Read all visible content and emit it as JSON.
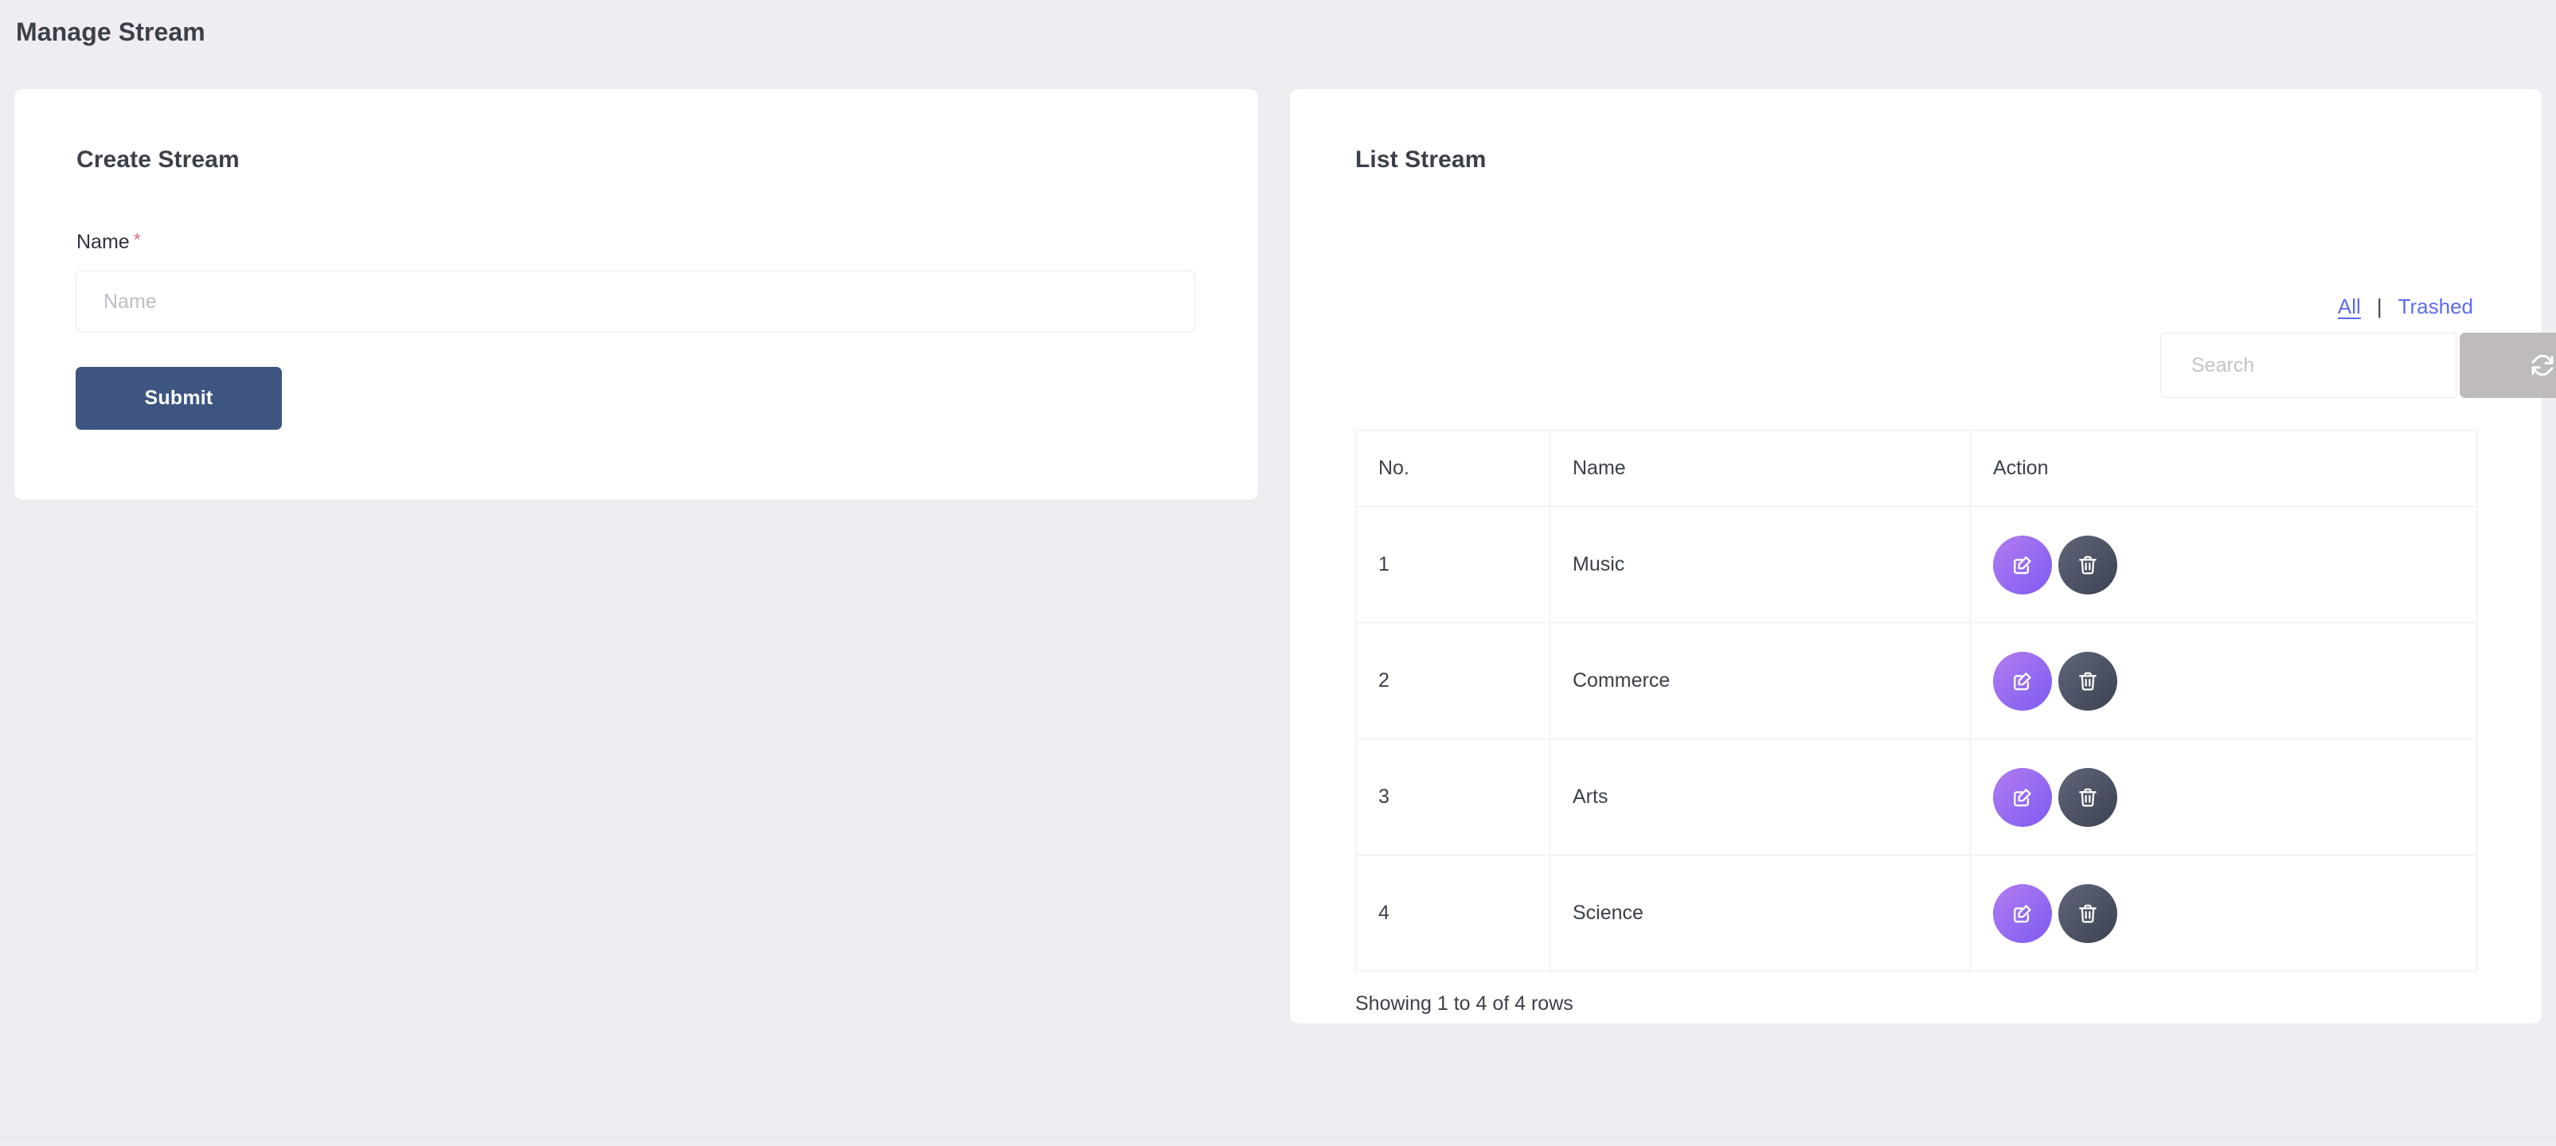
{
  "page": {
    "title": "Manage Stream"
  },
  "create_panel": {
    "title": "Create Stream",
    "name_label": "Name",
    "required_mark": "*",
    "name_placeholder": "Name",
    "name_value": "",
    "submit_label": "Submit"
  },
  "list_panel": {
    "title": "List Stream",
    "filters": {
      "all_label": "All",
      "separator": "|",
      "trashed_label": "Trashed",
      "active": "All"
    },
    "search": {
      "placeholder": "Search",
      "value": ""
    },
    "toolbar": {
      "refresh_icon": "refresh-icon",
      "columns_icon": "columns-list-icon",
      "export_icon": "export-download-icon"
    },
    "table": {
      "columns": [
        "No.",
        "Name",
        "Action"
      ],
      "rows": [
        {
          "no": "1",
          "name": "Music"
        },
        {
          "no": "2",
          "name": "Commerce"
        },
        {
          "no": "3",
          "name": "Arts"
        },
        {
          "no": "4",
          "name": "Science"
        }
      ],
      "row_actions": {
        "edit_icon": "edit-pencil-icon",
        "delete_icon": "trash-icon"
      }
    },
    "footer_text": "Showing 1 to 4 of 4 rows"
  },
  "colors": {
    "page_background": "#efedf2",
    "card_background": "#ffffff",
    "heading_text": "#3b4049",
    "link_blue": "#5c6bf2",
    "submit_blue": "#3d5580",
    "required_red": "#e06a80",
    "toolbar_gray": "#bfbbbb",
    "edit_purple_from": "#b27cf0",
    "edit_purple_to": "#7e5bf2",
    "delete_slate_from": "#5e6678",
    "delete_slate_to": "#3c4252",
    "border": "#eceaf1"
  }
}
